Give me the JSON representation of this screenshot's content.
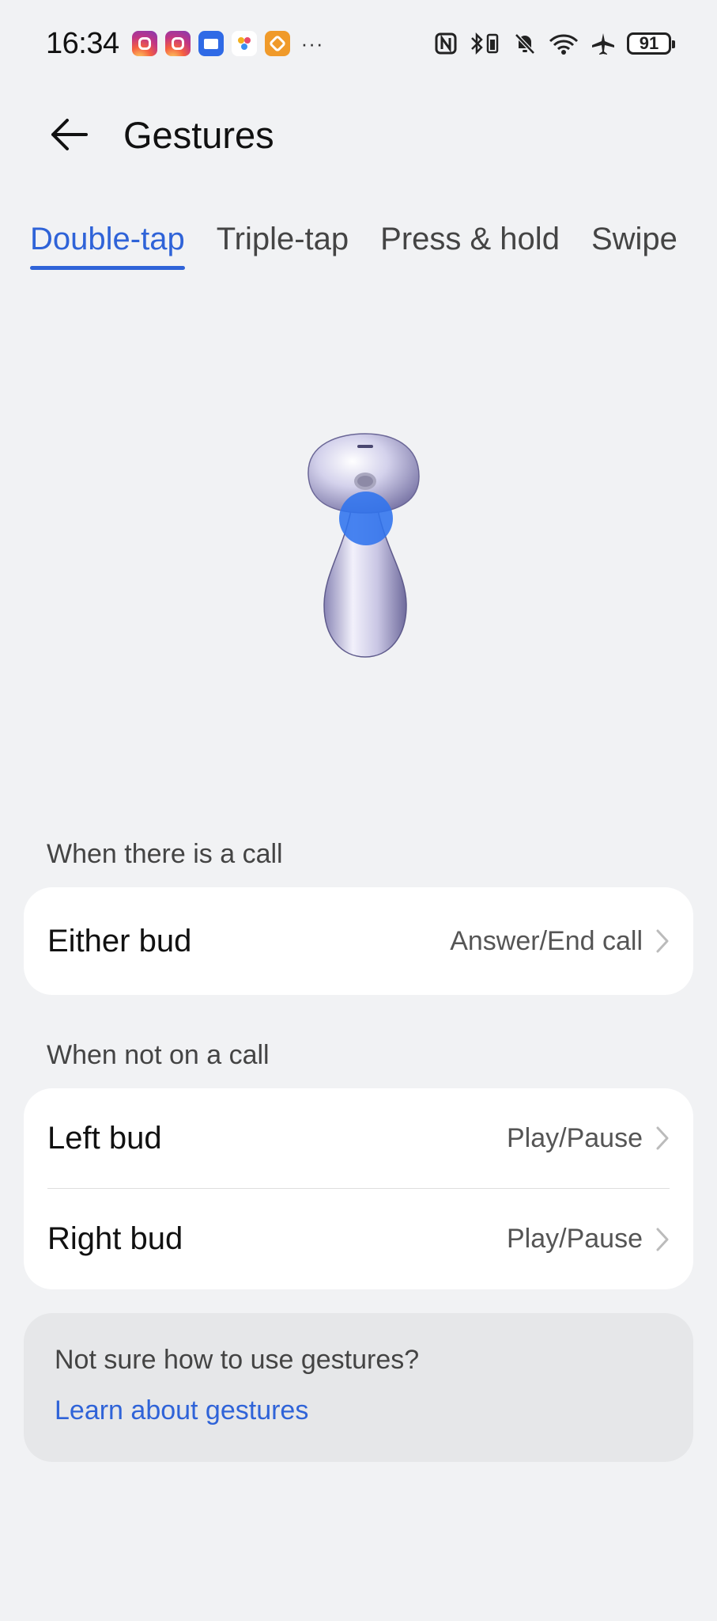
{
  "status_bar": {
    "time": "16:34",
    "more": "···",
    "battery": "91"
  },
  "header": {
    "title": "Gestures"
  },
  "tabs": [
    {
      "label": "Double-tap",
      "active": true
    },
    {
      "label": "Triple-tap",
      "active": false
    },
    {
      "label": "Press & hold",
      "active": false
    },
    {
      "label": "Swipe",
      "active": false
    }
  ],
  "sections": {
    "call": {
      "label": "When there is a call",
      "rows": [
        {
          "title": "Either bud",
          "value": "Answer/End call"
        }
      ]
    },
    "no_call": {
      "label": "When not on a call",
      "rows": [
        {
          "title": "Left bud",
          "value": "Play/Pause"
        },
        {
          "title": "Right bud",
          "value": "Play/Pause"
        }
      ]
    }
  },
  "help": {
    "text": "Not sure how to use gestures?",
    "link": "Learn about gestures"
  },
  "colors": {
    "accent": "#2f63d8",
    "background": "#f1f2f4",
    "card": "#ffffff",
    "tap_indicator": "#2f73ee"
  }
}
